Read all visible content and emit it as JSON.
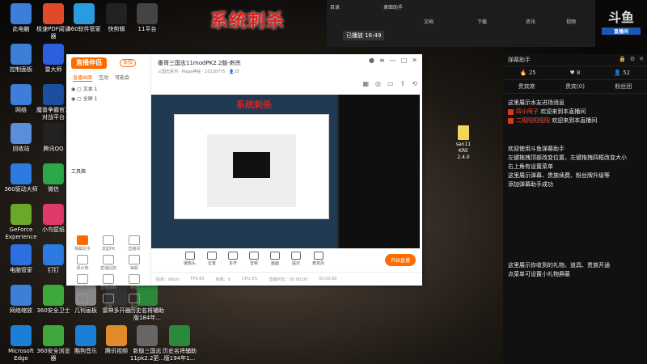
{
  "overlay_title": "系统刺杀",
  "desktop_icons": [
    {
      "label": "此电脑",
      "color": "#3d7ed8"
    },
    {
      "label": "极速PDF阅读器",
      "color": "#e04a2b"
    },
    {
      "label": "360软件管家",
      "color": "#2b9be0"
    },
    {
      "label": "快剪辑",
      "color": "#222222"
    },
    {
      "label": "11平台",
      "color": "#444444"
    },
    {
      "label": "控制面板",
      "color": "#3d7ed8"
    },
    {
      "label": "雷大师",
      "color": "#2b5fe0"
    },
    {
      "label": "网络",
      "color": "#3d7ed8"
    },
    {
      "label": "魔兽争霸官方对战平台",
      "color": "#1c4fa0"
    },
    {
      "label": "回收站",
      "color": "#5a8ed8"
    },
    {
      "label": "腾讯QQ",
      "color": "#222222"
    },
    {
      "label": "360驱动大师",
      "color": "#2b7be0"
    },
    {
      "label": "微信",
      "color": "#2aa84a"
    },
    {
      "label": "GeForce Experience",
      "color": "#6aa82a"
    },
    {
      "label": "小鸟壁纸",
      "color": "#e03a6a"
    },
    {
      "label": "电脑管家",
      "color": "#2b6fe0"
    },
    {
      "label": "钉钉",
      "color": "#2b7be0"
    },
    {
      "label": "网络缩放",
      "color": "#3d7ed8"
    },
    {
      "label": "360安全卫士",
      "color": "#3fa83a"
    },
    {
      "label": "几何画板",
      "color": "#888888"
    },
    {
      "label": "雷神多开器",
      "color": "#333333"
    },
    {
      "label": "历史名将辅助版184年...",
      "color": "#2a8a3a"
    },
    {
      "label": "Microsoft Edge",
      "color": "#1b7fd6"
    },
    {
      "label": "360安全浏览器",
      "color": "#3fa83a"
    },
    {
      "label": "酷狗音乐",
      "color": "#1b7fd6"
    },
    {
      "label": "腾讯视频",
      "color": "#e08a2b"
    },
    {
      "label": "新版三国志11pk2.2更...",
      "color": "#666666"
    },
    {
      "label": "历史名将辅助版194年1...",
      "color": "#2a8a3a"
    }
  ],
  "live_window": {
    "app_name": "直播伴侣",
    "app_badge": "体验",
    "source_tabs": [
      "直播画面",
      "互动",
      "可能会"
    ],
    "sources": [
      "文本 1",
      "全屏 1"
    ],
    "tools_label": "工具箱",
    "tools": [
      "弹幕助手",
      "发起PK",
      "直播间",
      "观众榜",
      "直播回放",
      "美颜",
      "切换设备",
      "直播录制",
      "特效",
      "语音",
      "设置",
      "更多"
    ],
    "stream_title": "番哥三国志11modPK2.2版-刺杀",
    "stream_meta": "三国志系列 · Mage神秘 · 10120775",
    "view_count": "25",
    "bottom_tools": [
      "摄像头",
      "位置",
      "多开",
      "音频",
      "画面",
      "提示",
      "麦克风"
    ],
    "start_button": "开始直播",
    "status_items": [
      "码率：0kb/s",
      "FPS:60",
      "帧率：0",
      "CPU:3%",
      "直播时长：00:00:00",
      "00:00:00"
    ]
  },
  "danmaku_panel": {
    "title": "弹幕助手",
    "stats": [
      "25",
      "8",
      "52"
    ],
    "tabs": [
      "贵宾席",
      "贵宾(0)",
      "粉丝团"
    ],
    "lines_top": [
      {
        "text": "这里展示水友进场消息",
        "tag": false,
        "name": ""
      },
      {
        "text": "欢迎来到本直播间",
        "tag": true,
        "name": "四小阿子"
      },
      {
        "text": "欢迎来到本直播间",
        "tag": true,
        "name": "二阳阳阳阳阳"
      }
    ],
    "lines_mid": [
      "欢迎使用斗鱼弹幕助手",
      "左键拖拽顶部改变位置，左键拖拽四框改变大小",
      "右上角有设置菜单",
      "这里展示弹幕、贵族续费、粉丝牌升级等",
      "添加弹幕助手成功"
    ],
    "lines_bottom": [
      "这里展示你收到的礼物、道具、贵族开通",
      "点菜单可设置小礼物屏蔽"
    ]
  },
  "top_screen": {
    "tabs": [
      "目录",
      "桌面助手",
      "文档",
      "下载",
      "资讯",
      "视频"
    ],
    "label_tag": "已播放 16:49",
    "brand": "斗鱼",
    "brand_sub": "直播间"
  },
  "desktop_file": {
    "name": "san11 KRE 2.4.0"
  }
}
